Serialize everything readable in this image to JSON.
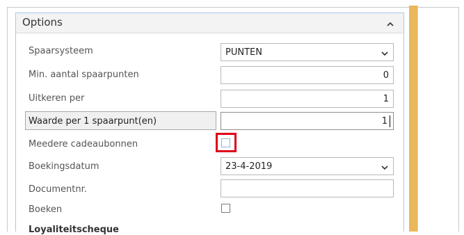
{
  "panel": {
    "title": "Options"
  },
  "fields": [
    {
      "label": "Spaarsysteem",
      "value": "PUNTEN",
      "type": "dropdown"
    },
    {
      "label": "Min. aantal spaarpunten",
      "value": "0",
      "type": "number"
    },
    {
      "label": "Uitkeren per",
      "value": "1",
      "type": "number"
    },
    {
      "label": "Waarde per 1 spaarpunt(en)",
      "value": "1",
      "type": "number",
      "focused": true
    },
    {
      "label": "Meedere cadeaubonnen",
      "checked": false,
      "type": "checkbox",
      "highlighted": true
    },
    {
      "label": "Boekingsdatum",
      "value": "23-4-2019",
      "type": "dropdown"
    },
    {
      "label": "Documentnr.",
      "value": "",
      "type": "text"
    },
    {
      "label": "Boeken",
      "checked": false,
      "type": "checkbox"
    }
  ],
  "next_section_label": "Loyaliteitscheque",
  "colors": {
    "highlight": "#e0001b",
    "scrollbar": "#e8b85a",
    "panel_border": "#a9c8e8"
  }
}
